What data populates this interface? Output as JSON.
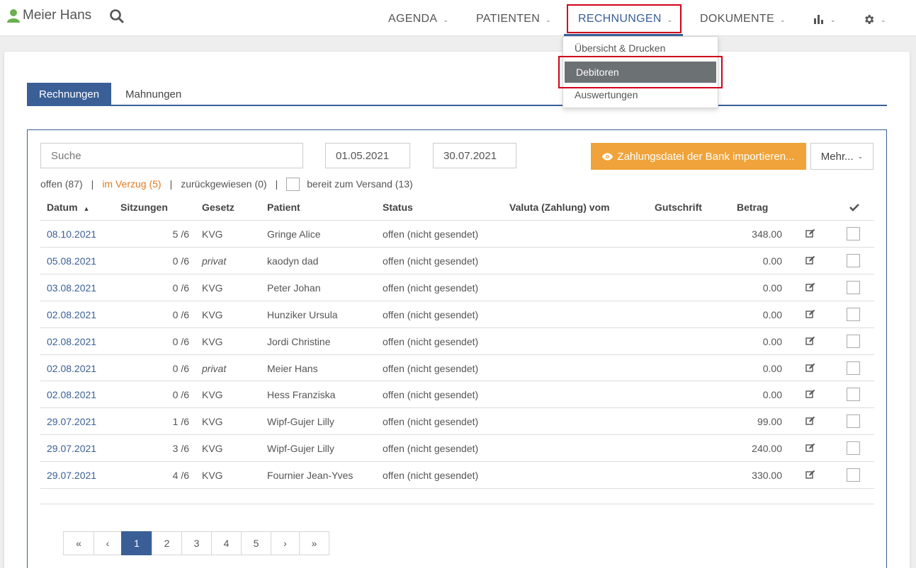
{
  "header": {
    "user_name": "Meier Hans",
    "nav": [
      {
        "label": "AGENDA"
      },
      {
        "label": "PATIENTEN"
      },
      {
        "label": "RECHNUNGEN"
      },
      {
        "label": "DOKUMENTE"
      }
    ]
  },
  "dropdown": {
    "items": [
      {
        "label": "Übersicht & Drucken"
      },
      {
        "label": "Debitoren"
      },
      {
        "label": "Auswertungen"
      }
    ]
  },
  "tabs": [
    {
      "label": "Rechnungen"
    },
    {
      "label": "Mahnungen"
    }
  ],
  "toolbar": {
    "search_placeholder": "Suche",
    "date_from": "01.05.2021",
    "date_to": "30.07.2021",
    "import_label": "Zahlungsdatei der Bank importieren...",
    "more_label": "Mehr..."
  },
  "filters": {
    "offen": "offen (87)",
    "verzug": "im Verzug (5)",
    "zurueck": "zurückgewiesen (0)",
    "versand": "bereit zum Versand (13)"
  },
  "table": {
    "headers": {
      "datum": "Datum",
      "sitzungen": "Sitzungen",
      "gesetz": "Gesetz",
      "patient": "Patient",
      "status": "Status",
      "valuta": "Valuta (Zahlung) vom",
      "gutschrift": "Gutschrift",
      "betrag": "Betrag"
    },
    "rows": [
      {
        "datum": "08.10.2021",
        "sitzungen": "5 /6",
        "gesetz": "KVG",
        "patient": "Gringe Alice",
        "status": "offen (nicht gesendet)",
        "betrag": "348.00"
      },
      {
        "datum": "05.08.2021",
        "sitzungen": "0 /6",
        "gesetz": "privat",
        "patient": "kaodyn dad",
        "status": "offen (nicht gesendet)",
        "betrag": "0.00"
      },
      {
        "datum": "03.08.2021",
        "sitzungen": "0 /6",
        "gesetz": "KVG",
        "patient": "Peter Johan",
        "status": "offen (nicht gesendet)",
        "betrag": "0.00"
      },
      {
        "datum": "02.08.2021",
        "sitzungen": "0 /6",
        "gesetz": "KVG",
        "patient": "Hunziker Ursula",
        "status": "offen (nicht gesendet)",
        "betrag": "0.00"
      },
      {
        "datum": "02.08.2021",
        "sitzungen": "0 /6",
        "gesetz": "KVG",
        "patient": "Jordi Christine",
        "status": "offen (nicht gesendet)",
        "betrag": "0.00"
      },
      {
        "datum": "02.08.2021",
        "sitzungen": "0 /6",
        "gesetz": "privat",
        "patient": "Meier Hans",
        "status": "offen (nicht gesendet)",
        "betrag": "0.00"
      },
      {
        "datum": "02.08.2021",
        "sitzungen": "0 /6",
        "gesetz": "KVG",
        "patient": "Hess Franziska",
        "status": "offen (nicht gesendet)",
        "betrag": "0.00"
      },
      {
        "datum": "29.07.2021",
        "sitzungen": "1 /6",
        "gesetz": "KVG",
        "patient": "Wipf-Gujer Lilly",
        "status": "offen (nicht gesendet)",
        "betrag": "99.00"
      },
      {
        "datum": "29.07.2021",
        "sitzungen": "3 /6",
        "gesetz": "KVG",
        "patient": "Wipf-Gujer Lilly",
        "status": "offen (nicht gesendet)",
        "betrag": "240.00"
      },
      {
        "datum": "29.07.2021",
        "sitzungen": "4 /6",
        "gesetz": "KVG",
        "patient": "Fournier Jean-Yves",
        "status": "offen (nicht gesendet)",
        "betrag": "330.00"
      }
    ]
  },
  "pagination": {
    "items": [
      "«",
      "‹",
      "1",
      "2",
      "3",
      "4",
      "5",
      "›",
      "»"
    ],
    "current": "1"
  },
  "colors": {
    "primary": "#3a5f96",
    "accent_orange": "#f0a33a",
    "highlight_red": "#d0021b",
    "user_green": "#6ab04c"
  }
}
